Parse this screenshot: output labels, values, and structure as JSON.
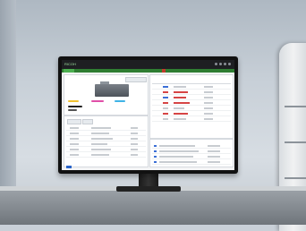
{
  "screen": {
    "app_logo_text": "RICOH",
    "colors": {
      "toolbar": "#1e1f22",
      "accent_green": "#4caf50",
      "error_red": "#d64545",
      "link_blue": "#3b6fd6",
      "ink_yellow": "#f2c230",
      "ink_magenta": "#e04fa8",
      "ink_cyan": "#3fb3e6",
      "ink_black": "#222222"
    }
  }
}
